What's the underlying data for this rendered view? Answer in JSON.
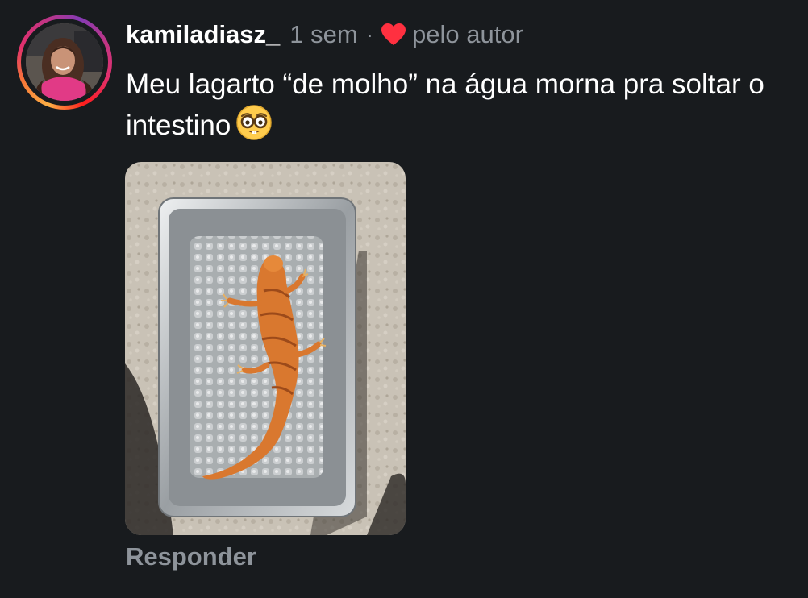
{
  "comment": {
    "username": "kamiladiasz_",
    "timestamp": "1 sem",
    "separator": "·",
    "liked_by": "pelo autor",
    "text": "Meu lagarto “de molho” na água morna pra soltar o intestino",
    "emoji": "nerd-face-emoji",
    "reply_label": "Responder"
  },
  "icons": {
    "heart": "heart-icon",
    "avatar": "avatar"
  },
  "colors": {
    "background": "#181b1e",
    "primary_text": "#ffffff",
    "secondary_text": "#8e949b",
    "heart": "#ff3040"
  }
}
